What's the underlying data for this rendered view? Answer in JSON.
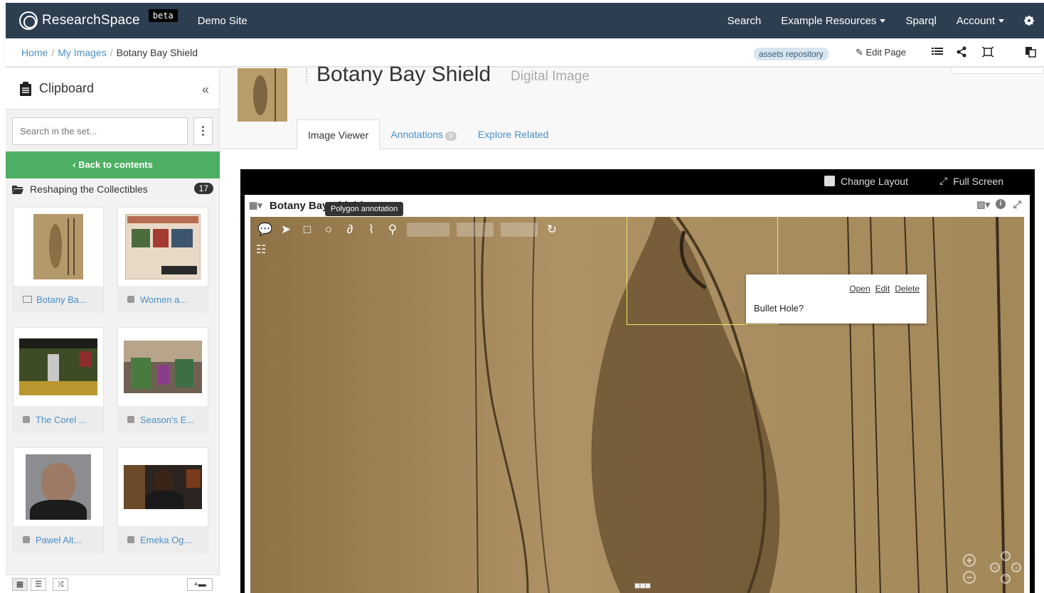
{
  "topbar": {
    "brand": "ResearchSpace",
    "beta": "beta",
    "site": "Demo Site",
    "nav": [
      "Search",
      "Example Resources",
      "Sparql",
      "Account"
    ]
  },
  "breadcrumb": {
    "home": "Home",
    "my_images": "My Images",
    "current": "Botany Bay Shield",
    "repo_badge": "assets repository",
    "edit_page": "Edit Page"
  },
  "clipboard": {
    "title": "Clipboard",
    "search_placeholder": "Search in the set...",
    "back_label": "Back to contents",
    "set_name": "Reshaping the Collectibles",
    "set_count": "17",
    "items": [
      {
        "label": "Botany Ba..."
      },
      {
        "label": "Women a..."
      },
      {
        "label": "The Corel ..."
      },
      {
        "label": "Season's E..."
      },
      {
        "label": "Paweł Alt..."
      },
      {
        "label": "Emeka Og..."
      }
    ]
  },
  "resource": {
    "title": "Botany Bay Shield",
    "type": "Digital Image",
    "tabs": [
      "Image Viewer",
      "Annotations",
      "Explore Related"
    ],
    "annotations_count": "0"
  },
  "viewer": {
    "change_layout": "Change Layout",
    "full_screen": "Full Screen",
    "panel_title": "Botany Bay Shield",
    "tooltip": "Polygon annotation",
    "annotation": {
      "open": "Open",
      "edit": "Edit",
      "delete": "Delete",
      "text": "Bullet Hole?"
    }
  },
  "colors": {
    "topbar": "#2d3e50",
    "link": "#4a90c8",
    "green": "#4caf63",
    "annotation_outline": "#e4ea6a"
  }
}
